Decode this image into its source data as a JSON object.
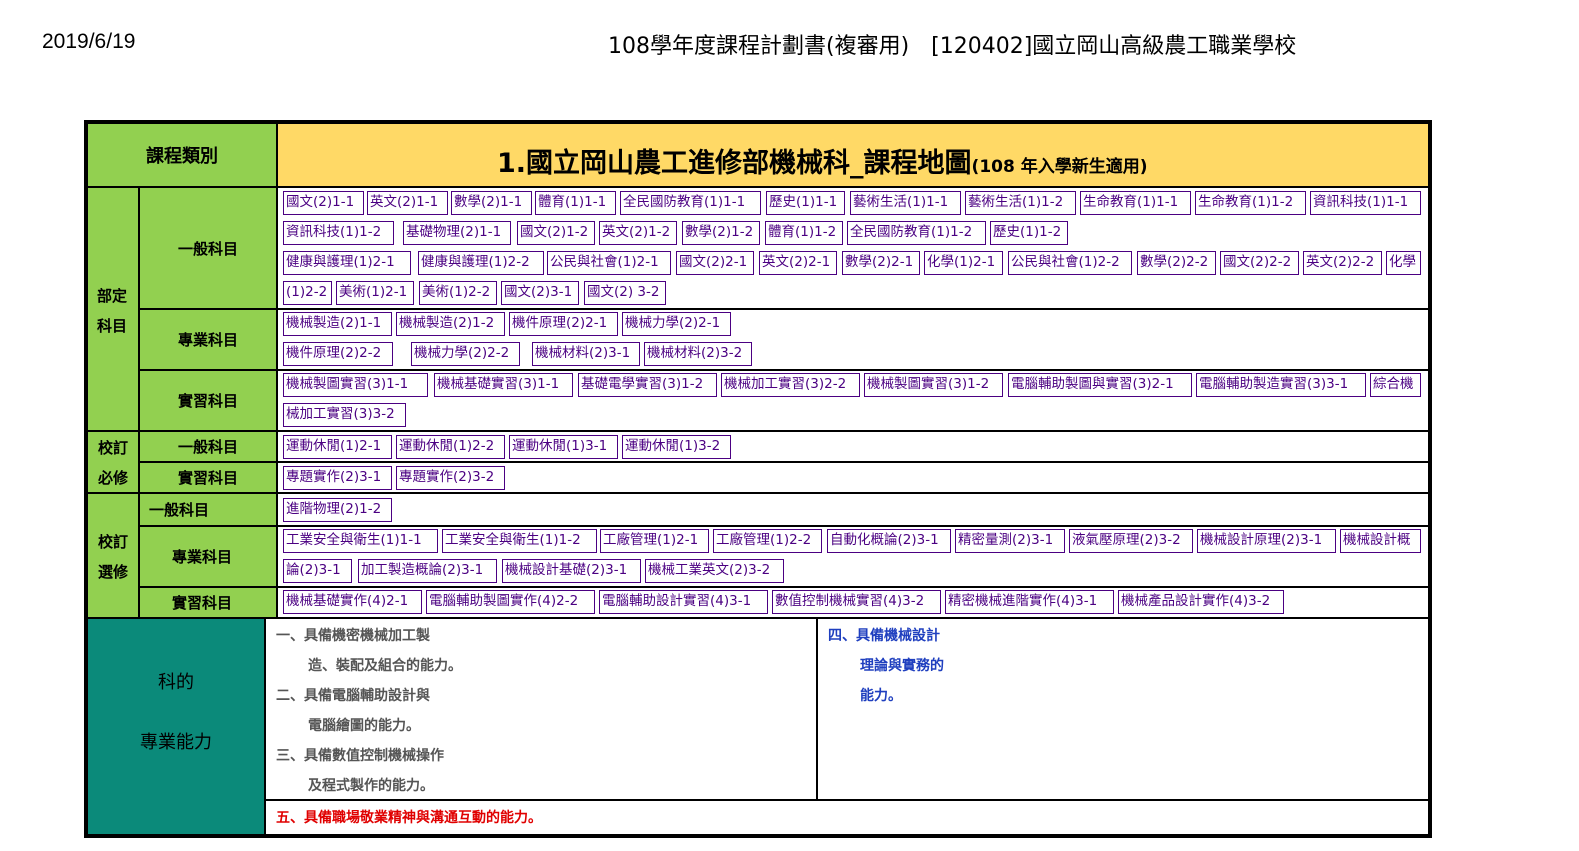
{
  "header": {
    "date": "2019/6/19",
    "title": "108學年度課程計劃書(複審用)　[120402]國立岡山高級農工職業學校"
  },
  "table": {
    "category_header": "課程類別",
    "title_main": "1.國立岡山農工進修部機械科_課程地圖",
    "title_sub": "(108 年入學新生適用)",
    "groups": {
      "bu_ding_line1": "部定",
      "bu_ding_line2": "科目",
      "xiao_bi_line1": "校訂",
      "xiao_bi_line2": "必修",
      "xiao_xuan_line1": "校訂",
      "xiao_xuan_line2": "選修"
    },
    "row_labels": {
      "bd_general": "一般科目",
      "bd_pro": "專業科目",
      "bd_prac": "實習科目",
      "xb_general": "一般科目",
      "xb_prac": "實習科目",
      "xx_general": "一般科目",
      "xx_pro": "專業科目",
      "xx_prac": "實習科目"
    },
    "courses": {
      "bd_general_1": [
        "國文(2)1-1",
        "英文(2)1-1",
        "數學(2)1-1",
        "體育(1)1-1",
        "全民國防教育(1)1-1",
        "歷史(1)1-1",
        "藝術生活(1)1-1",
        "藝術生活(1)1-2",
        "生命教育(1)1-1",
        "生命教育(1)1-2",
        "資訊科技(1)1-1"
      ],
      "bd_general_2": [
        "資訊科技(1)1-2",
        "基礎物理(2)1-1",
        "國文(2)1-2",
        "英文(2)1-2",
        "數學(2)1-2",
        "體育(1)1-2",
        "全民國防教育(1)1-2",
        "歷史(1)1-2"
      ],
      "bd_general_3": [
        "健康與護理(1)2-1",
        "健康與護理(1)2-2",
        "公民與社會(1)2-1",
        "國文(2)2-1",
        "英文(2)2-1",
        "數學(2)2-1",
        "化學(1)2-1",
        "公民與社會(1)2-2",
        "數學(2)2-2",
        "國文(2)2-2",
        "英文(2)2-2",
        "化學"
      ],
      "bd_general_4": [
        "(1)2-2",
        "美術(1)2-1",
        "美術(1)2-2",
        "國文(2)3-1",
        "國文(2) 3-2"
      ],
      "bd_pro_1": [
        "機械製造(2)1-1",
        "機械製造(2)1-2",
        "機件原理(2)2-1",
        "機械力學(2)2-1"
      ],
      "bd_pro_2": [
        "機件原理(2)2-2",
        "機械力學(2)2-2",
        "機械材料(2)3-1",
        "機械材料(2)3-2"
      ],
      "bd_prac_1": [
        "機械製圖實習(3)1-1",
        "機械基礎實習(3)1-1",
        "基礎電學實習(3)1-2",
        "機械加工實習(3)2-2",
        "機械製圖實習(3)1-2",
        "電腦輔助製圖與實習(3)2-1",
        "電腦輔助製造實習(3)3-1",
        "綜合機"
      ],
      "bd_prac_2": [
        "械加工實習(3)3-2"
      ],
      "xb_general_1": [
        "運動休閒(1)2-1",
        "運動休閒(1)2-2",
        "運動休閒(1)3-1",
        "運動休閒(1)3-2"
      ],
      "xb_prac_1": [
        "專題實作(2)3-1",
        "專題實作(2)3-2"
      ],
      "xx_general_1": [
        "進階物理(2)1-2"
      ],
      "xx_pro_1": [
        "工業安全與衛生(1)1-1",
        "工業安全與衛生(1)1-2",
        "工廠管理(1)2-1",
        "工廠管理(1)2-2",
        "自動化概論(2)3-1",
        "精密量測(2)3-1",
        "液氣壓原理(2)3-2",
        "機械設計原理(2)3-1",
        "機械設計概"
      ],
      "xx_pro_2": [
        "論(2)3-1",
        "加工製造概論(2)3-1",
        "機械設計基礎(2)3-1",
        "機械工業英文(2)3-2"
      ],
      "xx_prac_1": [
        "機械基礎實作(4)2-1",
        "電腦輔助製圖實作(4)2-2",
        "電腦輔助設計實習(4)3-1",
        "數值控制機械實習(4)3-2",
        "精密機械進階實作(4)3-1",
        "機械產品設計實作(4)3-2"
      ]
    },
    "competency": {
      "label_line1": "科的",
      "label_line2": "專業能力",
      "item1_line1": "一、具備機密機械加工製",
      "item1_line2": "造、裝配及組合的能力。",
      "item2_line1": "二、具備電腦輔助設計與",
      "item2_line2": "電腦繪圖的能力。",
      "item3_line1": "三、具備數值控制機械操作",
      "item3_line2": "及程式製作的能力。",
      "item4_line1": "四、具備機械設計",
      "item4_line2": "理論與實務的",
      "item4_line3": "能力。",
      "item5": "五、具備職場敬業精神與溝通互動的能力。"
    },
    "colors": {
      "green": "#92d050",
      "yellow": "#ffd966",
      "teal": "#0b8a7a",
      "chip_border": "#4b0082",
      "red_text": "#e00000",
      "blue_text": "#1f3fbf"
    }
  }
}
